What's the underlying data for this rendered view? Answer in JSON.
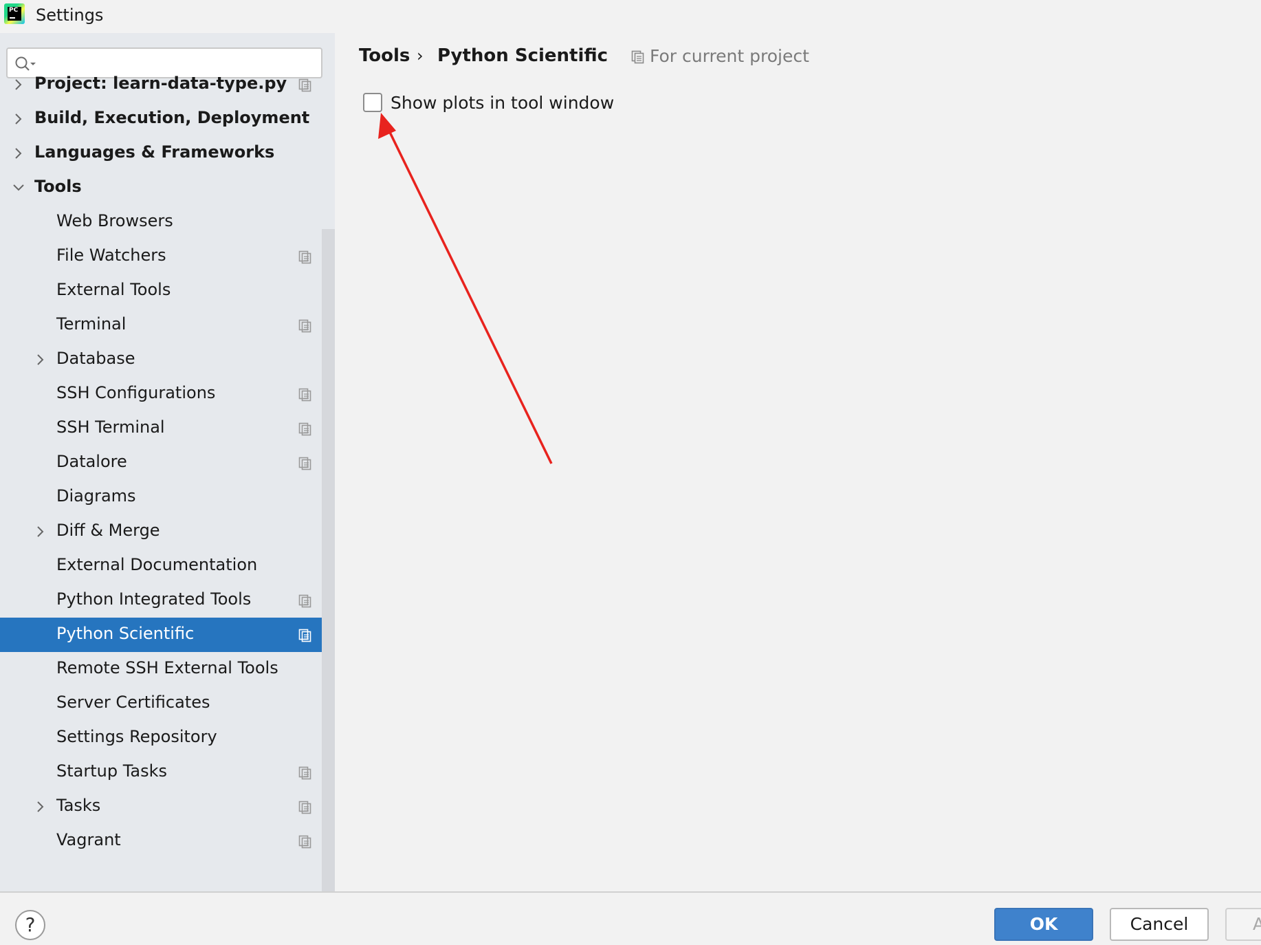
{
  "window": {
    "title": "Settings",
    "logo_text": "PC"
  },
  "search": {
    "value": "",
    "placeholder": ""
  },
  "tree": [
    {
      "label": "Project: learn-data-type.py",
      "level": 0,
      "arrow": "collapsed",
      "project_icon": true
    },
    {
      "label": "Build, Execution, Deployment",
      "level": 0,
      "arrow": "collapsed",
      "project_icon": false
    },
    {
      "label": "Languages & Frameworks",
      "level": 0,
      "arrow": "collapsed",
      "project_icon": false
    },
    {
      "label": "Tools",
      "level": 0,
      "arrow": "expanded",
      "project_icon": false
    },
    {
      "label": "Web Browsers",
      "level": 1,
      "arrow": "none",
      "project_icon": false
    },
    {
      "label": "File Watchers",
      "level": 1,
      "arrow": "none",
      "project_icon": true
    },
    {
      "label": "External Tools",
      "level": 1,
      "arrow": "none",
      "project_icon": false
    },
    {
      "label": "Terminal",
      "level": 1,
      "arrow": "none",
      "project_icon": true
    },
    {
      "label": "Database",
      "level": 1,
      "arrow": "collapsed",
      "project_icon": false
    },
    {
      "label": "SSH Configurations",
      "level": 1,
      "arrow": "none",
      "project_icon": true
    },
    {
      "label": "SSH Terminal",
      "level": 1,
      "arrow": "none",
      "project_icon": true
    },
    {
      "label": "Datalore",
      "level": 1,
      "arrow": "none",
      "project_icon": true
    },
    {
      "label": "Diagrams",
      "level": 1,
      "arrow": "none",
      "project_icon": false
    },
    {
      "label": "Diff & Merge",
      "level": 1,
      "arrow": "collapsed",
      "project_icon": false
    },
    {
      "label": "External Documentation",
      "level": 1,
      "arrow": "none",
      "project_icon": false
    },
    {
      "label": "Python Integrated Tools",
      "level": 1,
      "arrow": "none",
      "project_icon": true
    },
    {
      "label": "Python Scientific",
      "level": 1,
      "arrow": "none",
      "project_icon": true,
      "selected": true
    },
    {
      "label": "Remote SSH External Tools",
      "level": 1,
      "arrow": "none",
      "project_icon": false
    },
    {
      "label": "Server Certificates",
      "level": 1,
      "arrow": "none",
      "project_icon": false
    },
    {
      "label": "Settings Repository",
      "level": 1,
      "arrow": "none",
      "project_icon": false
    },
    {
      "label": "Startup Tasks",
      "level": 1,
      "arrow": "none",
      "project_icon": true
    },
    {
      "label": "Tasks",
      "level": 1,
      "arrow": "collapsed",
      "project_icon": true
    },
    {
      "label": "Vagrant",
      "level": 1,
      "arrow": "none",
      "project_icon": true
    }
  ],
  "breadcrumb": {
    "parent": "Tools",
    "separator": "›",
    "current": "Python Scientific"
  },
  "scope": {
    "label": "For current project",
    "icon": "project-scope-icon"
  },
  "option": {
    "label": "Show plots in tool window",
    "checked": false
  },
  "buttons": {
    "ok": "OK",
    "cancel": "Cancel",
    "apply": "A",
    "help": "?"
  },
  "colors": {
    "selection": "#2675bf",
    "sidebar_bg": "#e6e9ed",
    "annotation": "#e8231e",
    "ok_button": "#3f82cc"
  }
}
